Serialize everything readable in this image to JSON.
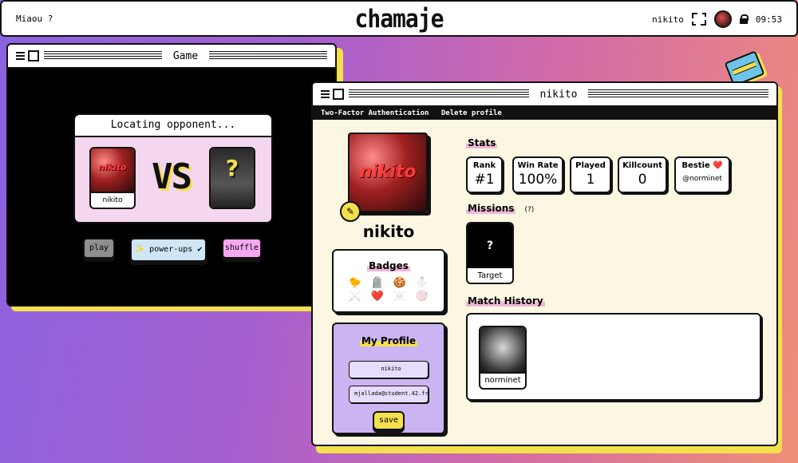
{
  "topbar": {
    "left_text": "Miaou ?",
    "logo": "chamaje",
    "username": "nikito",
    "time": "09:53"
  },
  "game_window": {
    "title": "Game",
    "status": "Locating opponent...",
    "player_name": "nikito",
    "player_pic_text": "nikito",
    "vs": "VS",
    "opponent_placeholder": "?",
    "buttons": {
      "play": "play",
      "powerups": "✨ power-ups ✔",
      "shuffle": "shuffle"
    },
    "colors": {
      "play": "#8f8f8f",
      "powerups": "#cfe6f7",
      "shuffle": "#f7a8f0"
    }
  },
  "profile_window": {
    "title": "nikito",
    "menu": [
      "Two-Factor Authentication",
      "Delete profile"
    ],
    "username": "nikito",
    "pic_text": "nikito",
    "badges": {
      "title": "Badges",
      "icons": [
        "🐤",
        "🪦",
        "🍪",
        "⛄",
        "⚔️",
        "❤️",
        "☠️",
        "🎯"
      ]
    },
    "my_profile": {
      "title": "My Profile",
      "username_value": "nikito",
      "email_value": "mjallada@student.42.fr",
      "save_label": "save"
    },
    "stats": {
      "title": "Stats",
      "rank_label": "Rank",
      "rank_value": "#1",
      "winrate_label": "Win Rate",
      "winrate_value": "100%",
      "played_label": "Played",
      "played_value": "1",
      "killcount_label": "Killcount",
      "killcount_value": "0",
      "bestie_label": "Bestie ❤️",
      "bestie_value": "@norminet"
    },
    "missions": {
      "title": "Missions",
      "help": "(?)",
      "card_mark": "?",
      "card_label": "Target"
    },
    "history": {
      "title": "Match History",
      "opponent": "norminet"
    }
  }
}
